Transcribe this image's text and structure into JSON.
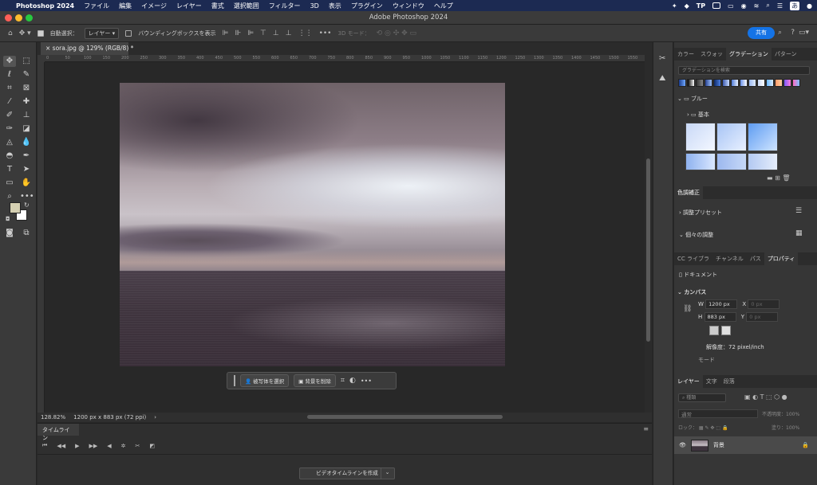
{
  "menubar": {
    "apple": "",
    "app": "Photoshop 2024",
    "items": [
      "ファイル",
      "編集",
      "イメージ",
      "レイヤー",
      "書式",
      "選択範囲",
      "フィルター",
      "3D",
      "表示",
      "プラグイン",
      "ウィンドウ",
      "ヘルプ"
    ],
    "tray_tp": "TP",
    "tray_a": "あ"
  },
  "window": {
    "title": "Adobe Photoshop 2024"
  },
  "options": {
    "auto_select_label": "自動選択：",
    "auto_select_value": "レイヤー",
    "bbox_label": "バウンディングボックスを表示",
    "mode_3d": "3D モード：",
    "share_label": "共有"
  },
  "doc": {
    "tab_title": "sora.jpg @ 129% (RGB/8) *",
    "ruler_ticks": [
      "0",
      "50",
      "100",
      "150",
      "200",
      "250",
      "300",
      "350",
      "400",
      "450",
      "500",
      "550",
      "600",
      "650",
      "700",
      "750",
      "800",
      "850",
      "900",
      "950",
      "1000",
      "1050",
      "1100",
      "1150",
      "1200",
      "1250",
      "1300",
      "1350",
      "1400",
      "1450",
      "1500",
      "1550",
      "1600"
    ]
  },
  "contextbar": {
    "select_subject": "被写体を選択",
    "remove_bg": "背景を削除",
    "more": "•••"
  },
  "status": {
    "zoom": "128.82%",
    "dims": "1200 px x 883 px (72 ppi)"
  },
  "timeline": {
    "tab": "タイムライン",
    "create_button": "ビデオタイムラインを作成"
  },
  "panels": {
    "tabs_top": [
      "カラー",
      "スウォッ",
      "グラデーション",
      "パターン"
    ],
    "gradient_search_placeholder": "グラデーションを検索",
    "folder_blue": "ブルー",
    "folder_basic": "基本",
    "adjust_title": "色調補正",
    "adjust_presets": "調整プリセット",
    "adjust_individual": "個々の調整",
    "tabs_mid": [
      "CC ライブラ",
      "チャンネル",
      "パス",
      "プロパティ"
    ],
    "document_label": "ドキュメント",
    "canvas_label": "カンバス",
    "w_label": "W",
    "w_value": "1200 px",
    "h_label": "H",
    "h_value": "883 px",
    "x_label": "X",
    "x_value": "0 px",
    "y_label": "Y",
    "y_value": "0 px",
    "resolution": "解像度：72 pixel/inch",
    "mode_label": "モード",
    "tabs_layers": [
      "レイヤー",
      "文字",
      "段落"
    ],
    "layer_search_placeholder": "種類",
    "blend_mode": "通常",
    "opacity_label": "不透明度：",
    "opacity_value": "100%",
    "lock_label": "ロック：",
    "fill_label": "塗り：",
    "fill_value": "100%",
    "layer_name": "背景"
  },
  "colors": {
    "accent": "#1473e6",
    "menubar": "#1c2a52",
    "panel": "#363636",
    "fg_swatch": "#d5d0b2",
    "bg_swatch": "#ffffff"
  }
}
